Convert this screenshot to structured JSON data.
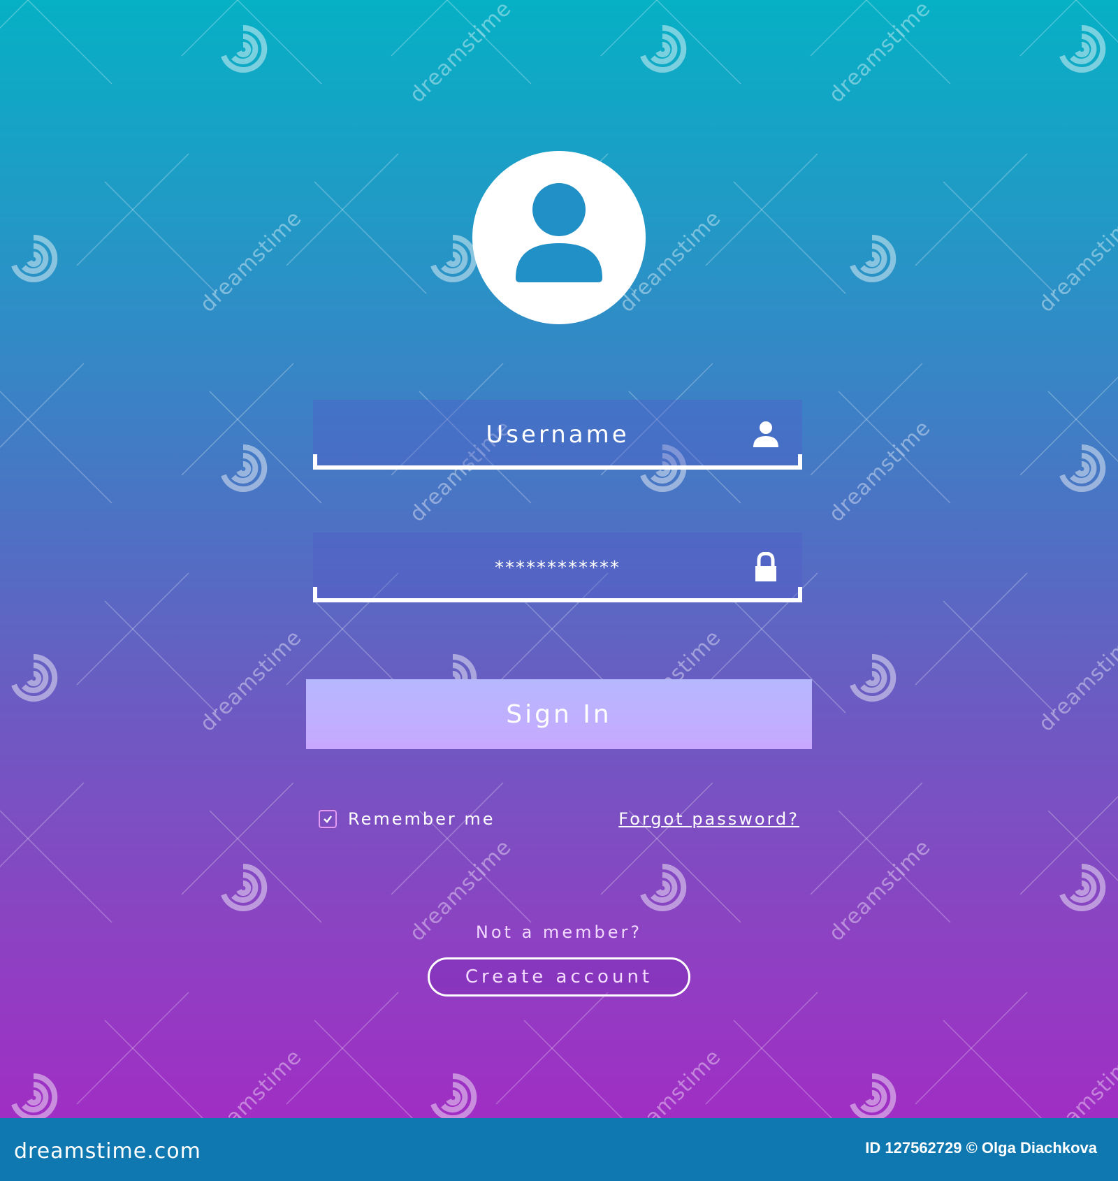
{
  "colors": {
    "gradient_top": "#06b0c5",
    "gradient_bottom": "#a02ec4",
    "avatar_glyph": "#2190c6",
    "signin_top": "#b6b8fe",
    "signin_bottom": "#c7a8fe",
    "footer": "#0f78b0"
  },
  "avatar": {
    "icon": "user-icon"
  },
  "username_field": {
    "placeholder": "Username",
    "icon": "user-icon"
  },
  "password_field": {
    "value": "************",
    "icon": "lock-icon"
  },
  "signin_button": {
    "label": "Sign In"
  },
  "remember_me": {
    "label": "Remember me",
    "checked": true
  },
  "forgot_password": {
    "label": "Forgot password?"
  },
  "signup": {
    "prompt": "Not a member?",
    "button_label": "Create account"
  },
  "watermark": {
    "text": "dreamstime"
  },
  "footer": {
    "logo": "dreamstime.com",
    "credit": "ID 127562729 © Olga Diachkova"
  }
}
